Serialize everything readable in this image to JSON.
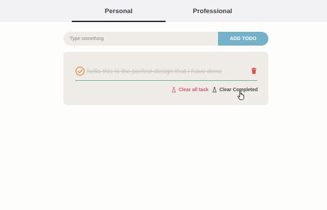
{
  "tabs": {
    "personal_label": "Personal",
    "professional_label": "Professional",
    "active": "Personal"
  },
  "input": {
    "placeholder": "Type something",
    "value": "",
    "add_label": "ADD TODO"
  },
  "todos": [
    {
      "text": "hello this is the perfect design that i have done",
      "completed": true
    }
  ],
  "actions": {
    "clear_all_label": "Clear all task",
    "clear_completed_label": "Clear Completed"
  },
  "icons": {
    "check": "check-circle-icon",
    "trash": "trash-icon",
    "clear_all": "flask-icon",
    "clear_completed": "flask-icon",
    "cursor": "hand-pointer-icon"
  },
  "colors": {
    "accent": "#74b2c9",
    "check": "#e08a3c",
    "trash": "#e04a4a",
    "clear_all": "#d15a72",
    "underline": "#6fbaa4",
    "card": "#efebe6"
  }
}
